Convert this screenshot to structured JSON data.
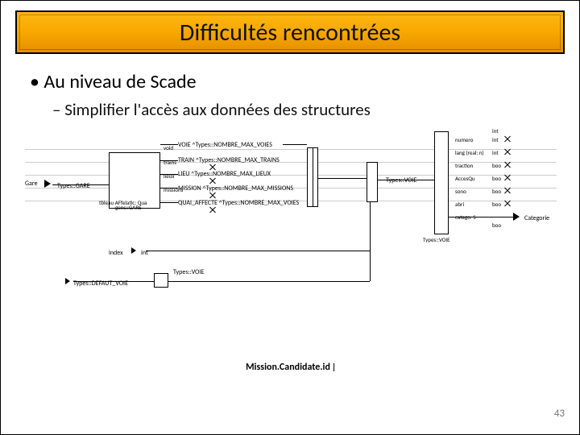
{
  "title": "Difficultés rencontrées",
  "bullets": {
    "level1": "Au niveau de Scade",
    "level2": "Simplifier l'accès aux données des structures"
  },
  "diagram": {
    "left_input": "Gare",
    "left_type": "Types::GARE",
    "fields_left": [
      "gens::GARE",
      "tbleau AFfelatic: Qua"
    ],
    "index_label": "index",
    "index_type": "int",
    "bottom_type_left": "Types::DEFAUT_VOIE",
    "bottom_type_mid": "Types::VOIE",
    "center_items": [
      "VOIE ^Types::NOMBRE_MAX_VOIES",
      "TRAIN ^Types::NOMBRE_MAX_TRAINS",
      "LIEU ^Types::NOMBRE_MAX_LIEUX",
      "MISSION ^Types::NOMBRE_MAX_MISSIONS",
      "QUAI_AFFECTE ^Types::NOMBRE_MAX_VOIES"
    ],
    "center_field_labels": [
      "void",
      "trains",
      "lieux",
      "missions"
    ],
    "right_type": "Types::VOIE",
    "right_output": "Categorie",
    "right_bar_label": "Types::VOIE",
    "right_fields": [
      {
        "name": "numero",
        "type": "int"
      },
      {
        "name": "lang (real: n)",
        "type": "int"
      },
      {
        "name": "traction",
        "type": "boo"
      },
      {
        "name": "AccesQu",
        "type": "boo"
      },
      {
        "name": "sono",
        "type": "boo"
      },
      {
        "name": "abri",
        "type": "boo"
      },
      {
        "name": "catego: S",
        "type": "boo"
      }
    ]
  },
  "caption": "Mission.Candidate.id",
  "page_number": "43"
}
